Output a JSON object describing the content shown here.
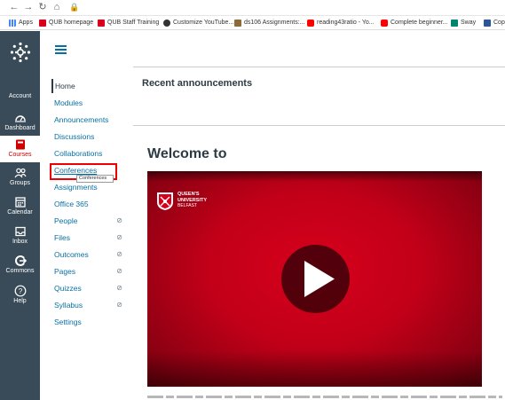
{
  "bookmarks": [
    {
      "label": "Apps",
      "icon": "apps-grid-icon",
      "color": "#4285f4"
    },
    {
      "label": "QUB homepage",
      "icon": "qub-favicon-icon",
      "color": "#d6001c"
    },
    {
      "label": "QUB Staff Training",
      "icon": "qub-favicon-icon",
      "color": "#d6001c"
    },
    {
      "label": "Customize YouTube...",
      "icon": "globe-favicon-icon",
      "color": "#333333"
    },
    {
      "label": "ds106 Assignments:...",
      "icon": "ds106-favicon-icon",
      "color": "#8b6b3a"
    },
    {
      "label": "reading43ratio - Yo...",
      "icon": "youtube-favicon-icon",
      "color": "#ff0000"
    },
    {
      "label": "Complete beginner...",
      "icon": "youtube-favicon-icon",
      "color": "#ff0000"
    },
    {
      "label": "Sway",
      "icon": "sway-favicon-icon",
      "color": "#008272"
    },
    {
      "label": "Cop",
      "icon": "doc-favicon-icon",
      "color": "#2b579a"
    }
  ],
  "global_nav": {
    "account": "Account",
    "dashboard": "Dashboard",
    "courses": "Courses",
    "groups": "Groups",
    "calendar": "Calendar",
    "inbox": "Inbox",
    "commons": "Commons",
    "help": "Help"
  },
  "course_nav": [
    {
      "label": "Home",
      "active": true,
      "hidden": false
    },
    {
      "label": "Modules",
      "hidden": false
    },
    {
      "label": "Announcements",
      "hidden": false
    },
    {
      "label": "Discussions",
      "hidden": false
    },
    {
      "label": "Collaborations",
      "hidden": false
    },
    {
      "label": "Conferences",
      "hidden": false
    },
    {
      "label": "Assignments",
      "hidden": false
    },
    {
      "label": "Office 365",
      "hidden": false
    },
    {
      "label": "People",
      "hidden": true
    },
    {
      "label": "Files",
      "hidden": true
    },
    {
      "label": "Outcomes",
      "hidden": true
    },
    {
      "label": "Pages",
      "hidden": true
    },
    {
      "label": "Quizzes",
      "hidden": true
    },
    {
      "label": "Syllabus",
      "hidden": true
    },
    {
      "label": "Settings",
      "hidden": false
    }
  ],
  "tooltip": "Conferences",
  "main": {
    "recent_announcements": "Recent announcements",
    "welcome_heading": "Welcome to",
    "video": {
      "logo_line1": "QUEEN'S",
      "logo_line2": "UNIVERSITY",
      "logo_line3": "BELFAST"
    }
  },
  "colors": {
    "accent": "#0770a3",
    "nav_bg": "#394b58",
    "brand_red": "#d6001c",
    "highlight": "#e00000"
  }
}
